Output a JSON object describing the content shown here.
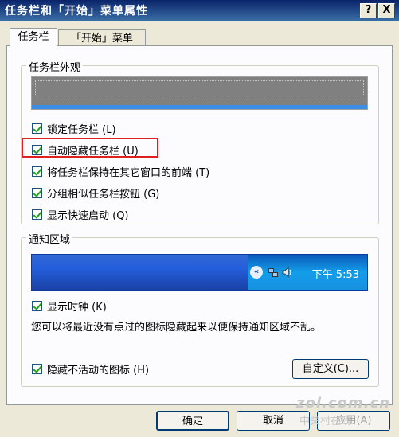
{
  "window": {
    "title": "任务栏和「开始」菜单属性"
  },
  "titlebar_buttons": {
    "help": "?",
    "close": "X"
  },
  "tabs": [
    {
      "label": "任务栏",
      "active": true
    },
    {
      "label": "「开始」菜单",
      "active": false
    }
  ],
  "taskbar_appearance": {
    "label": "任务栏外观",
    "options": [
      {
        "label": "锁定任务栏 (L)",
        "checked": true
      },
      {
        "label": "自动隐藏任务栏 (U)",
        "checked": true
      },
      {
        "label": "将任务栏保持在其它窗口的前端 (T)",
        "checked": true
      },
      {
        "label": "分组相似任务栏按钮 (G)",
        "checked": true
      },
      {
        "label": "显示快速启动 (Q)",
        "checked": true
      }
    ]
  },
  "notification_area": {
    "label": "通知区域",
    "tray_time": "下午 5:53",
    "show_clock": {
      "label": "显示时钟 (K)",
      "checked": true
    },
    "info_text": "您可以将最近没有点过的图标隐藏起来以便保持通知区域不乱。",
    "hide_inactive": {
      "label": "隐藏不活动的图标 (H)",
      "checked": true
    },
    "customize_button": "自定义(C)..."
  },
  "footer": {
    "ok": "确定",
    "cancel": "取消",
    "apply": "应用(A)"
  },
  "watermark": {
    "main": "zol.com.cn",
    "sub": "中关村在线"
  },
  "colors": {
    "title_bar": "#0a246a",
    "highlight_box": "#e02020",
    "tray_blue": "#245edb"
  }
}
